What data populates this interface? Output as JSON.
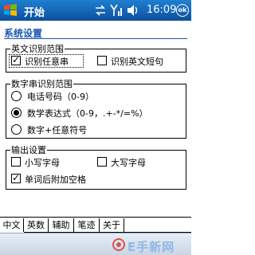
{
  "titlebar": {
    "app_title": "开始",
    "clock": "16:09",
    "ok_label": "ok"
  },
  "page": {
    "title": "系统设置"
  },
  "groups": {
    "text_recognition": {
      "title": "英文识别范围",
      "options": [
        {
          "label": "识别任意串",
          "checked": true
        },
        {
          "label": "识别英文短句",
          "checked": false
        }
      ]
    },
    "number_recognition": {
      "title": "数字串识别范围",
      "options": [
        {
          "label": "电话号码（0-9）",
          "selected": false
        },
        {
          "label": "数学表达式（0-9，.+-*/=%）",
          "selected": true
        },
        {
          "label": "数字+任意符号",
          "selected": false
        }
      ]
    },
    "output": {
      "title": "输出设置",
      "options": [
        {
          "label": "小写字母",
          "checked": false
        },
        {
          "label": "大写字母",
          "checked": false
        },
        {
          "label": "单词后附加空格",
          "checked": true
        }
      ]
    }
  },
  "tabs": [
    {
      "label": "中文",
      "active": true
    },
    {
      "label": "英数",
      "active": false
    },
    {
      "label": "辅助",
      "active": false
    },
    {
      "label": "笔迹",
      "active": false
    },
    {
      "label": "关于",
      "active": false
    }
  ],
  "watermark": {
    "text": "E手新网"
  },
  "colors": {
    "titlebar": "#0d4f9e",
    "heading": "#1a56b0"
  }
}
